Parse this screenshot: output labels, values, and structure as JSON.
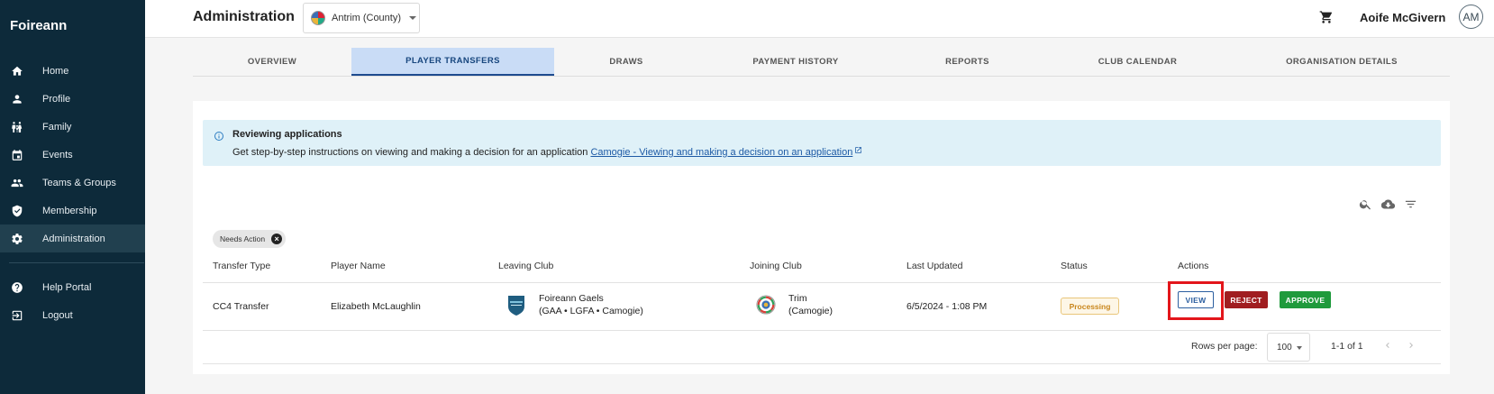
{
  "sidebar": {
    "brand": "Foireann",
    "items": [
      {
        "label": "Home",
        "icon": "home-icon"
      },
      {
        "label": "Profile",
        "icon": "person-icon"
      },
      {
        "label": "Family",
        "icon": "family-icon"
      },
      {
        "label": "Events",
        "icon": "calendar-icon"
      },
      {
        "label": "Teams & Groups",
        "icon": "group-icon"
      },
      {
        "label": "Membership",
        "icon": "shield-icon"
      },
      {
        "label": "Administration",
        "icon": "gear-icon",
        "active": true
      }
    ],
    "footer_items": [
      {
        "label": "Help Portal",
        "icon": "help-icon"
      },
      {
        "label": "Logout",
        "icon": "logout-icon"
      }
    ]
  },
  "header": {
    "title": "Administration",
    "organisation": "Antrim (County)",
    "user_name": "Aoife McGivern",
    "avatar_initials": "AM"
  },
  "tabs": [
    {
      "label": "OVERVIEW"
    },
    {
      "label": "PLAYER TRANSFERS",
      "active": true
    },
    {
      "label": "DRAWS"
    },
    {
      "label": "PAYMENT HISTORY"
    },
    {
      "label": "REPORTS"
    },
    {
      "label": "CLUB CALENDAR"
    },
    {
      "label": "ORGANISATION DETAILS"
    }
  ],
  "info": {
    "title": "Reviewing applications",
    "text": "Get step-by-step instructions on viewing and making a decision for an application ",
    "link": "Camogie - Viewing and making a decision on an application"
  },
  "filter_chip": "Needs Action",
  "table": {
    "columns": [
      "Transfer Type",
      "Player Name",
      "Leaving Club",
      "Joining Club",
      "Last Updated",
      "Status",
      "Actions"
    ],
    "rows": [
      {
        "transfer_type": "CC4 Transfer",
        "player_name": "Elizabeth McLaughlin",
        "leaving_club_name": "Foireann Gaels",
        "leaving_club_codes": "(GAA • LGFA • Camogie)",
        "joining_club_name": "Trim",
        "joining_club_codes": "(Camogie)",
        "last_updated": "6/5/2024 - 1:08 PM",
        "status": "Processing",
        "actions": {
          "view": "VIEW",
          "reject": "REJECT",
          "approve": "APPROVE"
        }
      }
    ]
  },
  "pagination": {
    "rows_per_page_label": "Rows per page:",
    "rows_per_page": "100",
    "range": "1-1 of 1"
  },
  "colors": {
    "sidebar_bg": "#0d2a3a",
    "active_tab_bg": "#c9dcf6",
    "info_bg": "#dff1f8",
    "reject": "#a01d20",
    "approve": "#1f9a3c",
    "highlight": "#e3161b"
  }
}
